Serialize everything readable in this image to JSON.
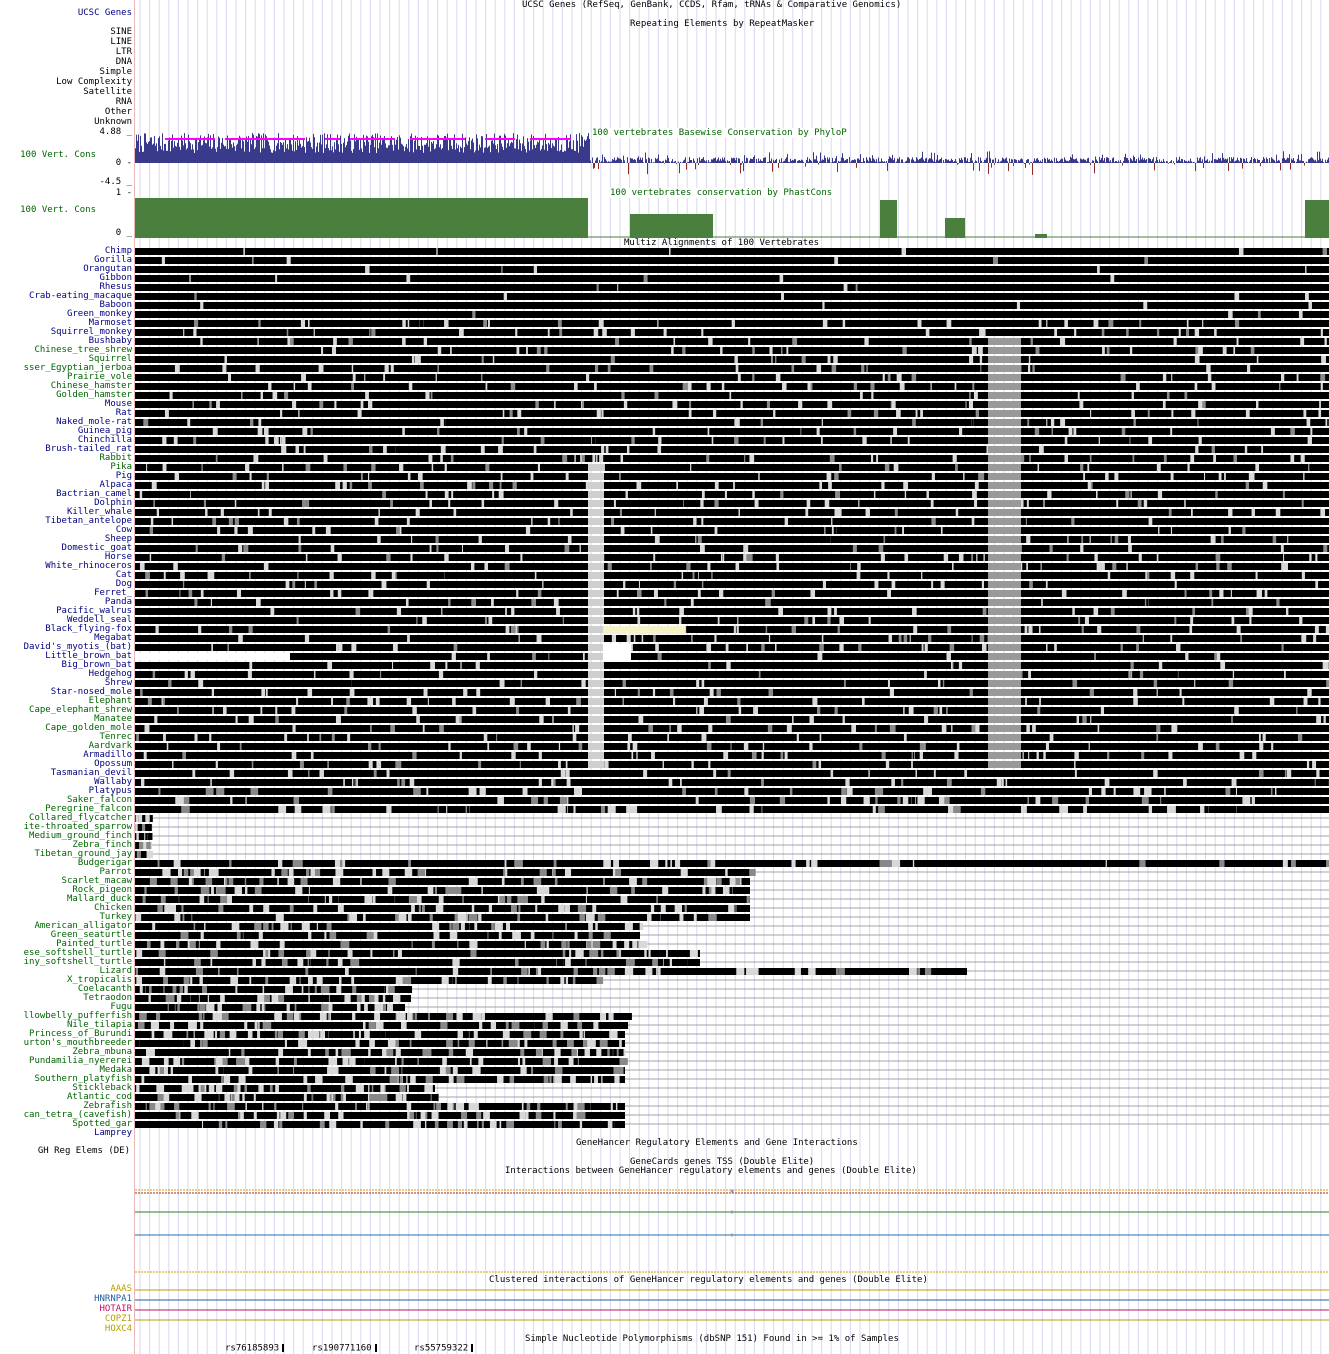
{
  "colors": {
    "label_blue": "#000080",
    "label_green": "#006400",
    "phylop_pos": "#3a3a8c",
    "phylop_neg": "#8b2a2a",
    "phylop_cap": "#ff00ff",
    "phastcons": "#4a7f3e",
    "gridline": "#d9d9ef",
    "hotair": "#c0106a",
    "hnrnpa1": "#1f5fa0",
    "aaas": "#b8a000",
    "copz1": "#b8a000",
    "hoxc4": "#b8a000",
    "gh_green": "#2e7a2e",
    "gh_blue": "#1f6fb0",
    "gh_orange": "#d4a000",
    "gh_red": "#b02020"
  },
  "tracks": {
    "ucsc_genes": {
      "label": "UCSC Genes",
      "title": "UCSC Genes (RefSeq, GenBank, CCDS, Rfam, tRNAs & Comparative Genomics)"
    },
    "repeatmasker": {
      "title": "Repeating Elements by RepeatMasker",
      "classes": [
        "SINE",
        "LINE",
        "LTR",
        "DNA",
        "Simple",
        "Low Complexity",
        "Satellite",
        "RNA",
        "Other",
        "Unknown"
      ]
    },
    "phylop": {
      "label": "100 Vert. Cons",
      "title": "100 vertebrates Basewise Conservation by PhyloP",
      "ymax": "4.88 _",
      "yzero": "0 -",
      "ymin": "-4.5 _"
    },
    "phastcons": {
      "label": "100 Vert. Cons",
      "title": "100 vertebrates conservation by PhastCons",
      "ymax": "1 -",
      "ymin": "0 _"
    },
    "multiz": {
      "title": "Multiz Alignments of 100 Vertebrates",
      "species": [
        "Chimp",
        "Gorilla",
        "Orangutan",
        "Gibbon",
        "Rhesus",
        "Crab-eating_macaque",
        "Baboon",
        "Green_monkey",
        "Marmoset",
        "Squirrel_monkey",
        "Bushbaby",
        "Chinese_tree_shrew",
        "Squirrel",
        "sser_Egyptian_jerboa",
        "Prairie_vole",
        "Chinese_hamster",
        "Golden_hamster",
        "Mouse",
        "Rat",
        "Naked_mole-rat",
        "Guinea_pig",
        "Chinchilla",
        "Brush-tailed_rat",
        "Rabbit",
        "Pika",
        "Pig",
        "Alpaca",
        "Bactrian_camel",
        "Dolphin",
        "Killer_whale",
        "Tibetan_antelope",
        "Cow",
        "Sheep",
        "Domestic_goat",
        "Horse",
        "White_rhinoceros",
        "Cat",
        "Dog",
        "Ferret_",
        "Panda",
        "Pacific_walrus",
        "Weddell_seal",
        "Black_flying-fox",
        "Megabat",
        "David's_myotis_(bat)",
        "Little_brown_bat",
        "Big_brown_bat",
        "Hedgehog",
        "Shrew",
        "Star-nosed_mole",
        "Elephant",
        "Cape_elephant_shrew",
        "Manatee",
        "Cape_golden_mole",
        "Tenrec",
        "Aardvark",
        "Armadillo",
        "Opossum",
        "Tasmanian_devil",
        "Wallaby",
        "Platypus",
        "Saker_falcon",
        "Peregrine_falcon",
        "Collared_flycatcher",
        "ite-throated_sparrow",
        "Medium_ground_finch",
        "Zebra_finch",
        "Tibetan_ground_jay",
        "Budgerigar",
        "Parrot",
        "Scarlet_macaw",
        "Rock_pigeon",
        "Mallard_duck",
        "Chicken",
        "Turkey",
        "American_alligator",
        "Green_seaturtle",
        "Painted_turtle",
        "ese_softshell_turtle",
        "iny_softshell_turtle",
        "Lizard",
        "X_tropicalis",
        "Coelacanth",
        "Tetraodon",
        "Fugu",
        "llowbelly_pufferfish",
        "Nile_tilapia",
        "Princess_of_Burundi",
        "urton's_mouthbreeder",
        "Zebra_mbuna",
        "Pundamilia_nyererei",
        "Medaka",
        "Southern_platyfish",
        "Stickleback",
        "Atlantic_cod",
        "Zebrafish",
        "can_tetra_(cavefish)",
        "Spotted_gar",
        "Lamprey"
      ]
    },
    "genehancer": {
      "title": "GeneHancer Regulatory Elements and Gene Interactions",
      "label": "GH Reg Elems (DE)",
      "tss_title": "GeneCards genes TSS (Double Elite)",
      "interactions_title": "Interactions between GeneHancer regulatory elements and genes (Double Elite)",
      "clustered_title": "Clustered interactions of GeneHancer regulatory elements and genes (Double Elite)",
      "genes": [
        "AAAS",
        "HNRNPA1",
        "HOTAIR",
        "COPZ1",
        "HOXC4"
      ]
    },
    "snp": {
      "title": "Simple Nucleotide Polymorphisms (dbSNP 151) Found in >= 1% of Samples",
      "items": [
        "rs76185893",
        "rs190771160",
        "rs55759322"
      ]
    }
  }
}
